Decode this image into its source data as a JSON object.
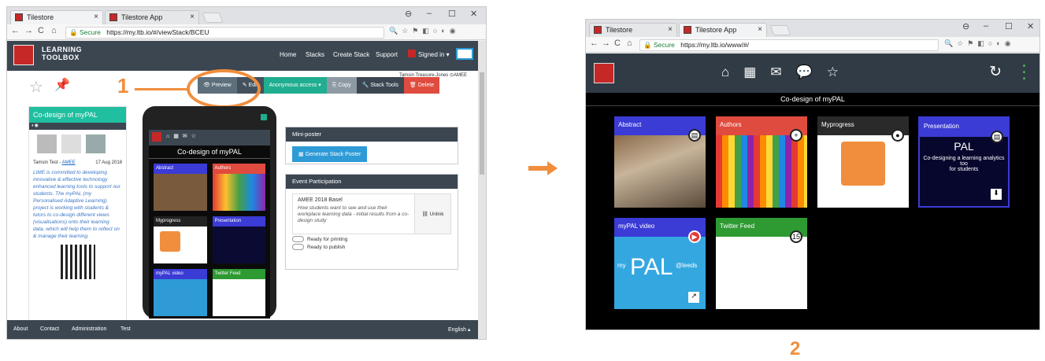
{
  "left": {
    "tabs": [
      {
        "label": "Tilestore"
      },
      {
        "label": "Tilestore App"
      }
    ],
    "addr": {
      "secure": "Secure",
      "url": "https://my.ltb.io/#/viewStack/BCEU"
    },
    "logo_text": [
      "LEARNING",
      "TOOLBOX"
    ],
    "nav": [
      "Home",
      "Stacks",
      "Create Stack",
      "Support",
      "Signed in ▾"
    ],
    "user_line": "Tamsin Treasure-Jones  ⊙AMEE",
    "toolbar": [
      {
        "label": "Preview",
        "color": "#5c6f7b"
      },
      {
        "label": "Edit",
        "color": "#44515c"
      },
      {
        "label": "Anonymous access ▾",
        "color": "#1fae8f"
      },
      {
        "label": "Copy",
        "color": "#8e9aa3"
      },
      {
        "label": "Stack Tools",
        "color": "#3b4651"
      },
      {
        "label": "Delete",
        "color": "#e04b3f"
      }
    ],
    "callout_number": "1",
    "card": {
      "title": "Co-design of myPAL",
      "author": "Tamsin Test - AMEE",
      "author_name": "Tamsin Test - ",
      "author_link": "AMEE",
      "date": "17 Aug 2018",
      "description": "LIME is committed to developing innovative & effective technology enhanced learning tools to support our students. The myPAL (my Personalised Adaptive Learning) project is working with students & tutors to co-design different views (visualisations) onto their learning data, which will help them to reflect on & manage their learning."
    },
    "phone": {
      "title": "Co-design of myPAL",
      "tiles": [
        {
          "label": "Abstract",
          "color": "#3b3bd6"
        },
        {
          "label": "Authors",
          "color": "#e04b3f"
        },
        {
          "label": "Myprogress",
          "color": "#222"
        },
        {
          "label": "Presentation",
          "color": "#3b3bd6"
        },
        {
          "label": "myPAL video",
          "color": "#3b3bd6"
        },
        {
          "label": "Twitter Feed",
          "color": "#2e9a32"
        }
      ]
    },
    "mini_poster": {
      "header": "Mini-poster",
      "button": "Generate Stack Poster"
    },
    "event": {
      "header": "Event Participation",
      "name": "AMEE 2018 Basel",
      "desc": "How students want to see and use their workplace learning data - initial results from a co-design study",
      "unlink": "Unlink",
      "toggle1": "Ready for printing",
      "toggle2": "Ready to publish"
    },
    "footer": [
      "About",
      "Contact",
      "Administration",
      "Test",
      "English ▴"
    ]
  },
  "right": {
    "tabs": [
      {
        "label": "Tilestore"
      },
      {
        "label": "Tilestore App"
      }
    ],
    "addr": {
      "secure": "Secure",
      "url": "https://my.ltb.io/www/#/"
    },
    "title": "Co-design of myPAL",
    "tiles": [
      {
        "label": "Abstract",
        "color": "#3b3bd6"
      },
      {
        "label": "Authors",
        "color": "#e04b3f"
      },
      {
        "label": "Myprogress",
        "color": "#2a2a2a"
      },
      {
        "label": "Presentation",
        "color": "#3b3bd6"
      },
      {
        "label": "myPAL video",
        "color": "#3b3bd6"
      },
      {
        "label": "Twitter Feed",
        "color": "#2e9a32"
      }
    ],
    "twitter_count": "15",
    "pres_lines": [
      "Co-designing a learning analytics too",
      "for students"
    ],
    "pres_brand": "PAL",
    "video_brand": "PAL",
    "video_my": "my",
    "video_leeds": "@leeds"
  },
  "callout_number_2": "2"
}
